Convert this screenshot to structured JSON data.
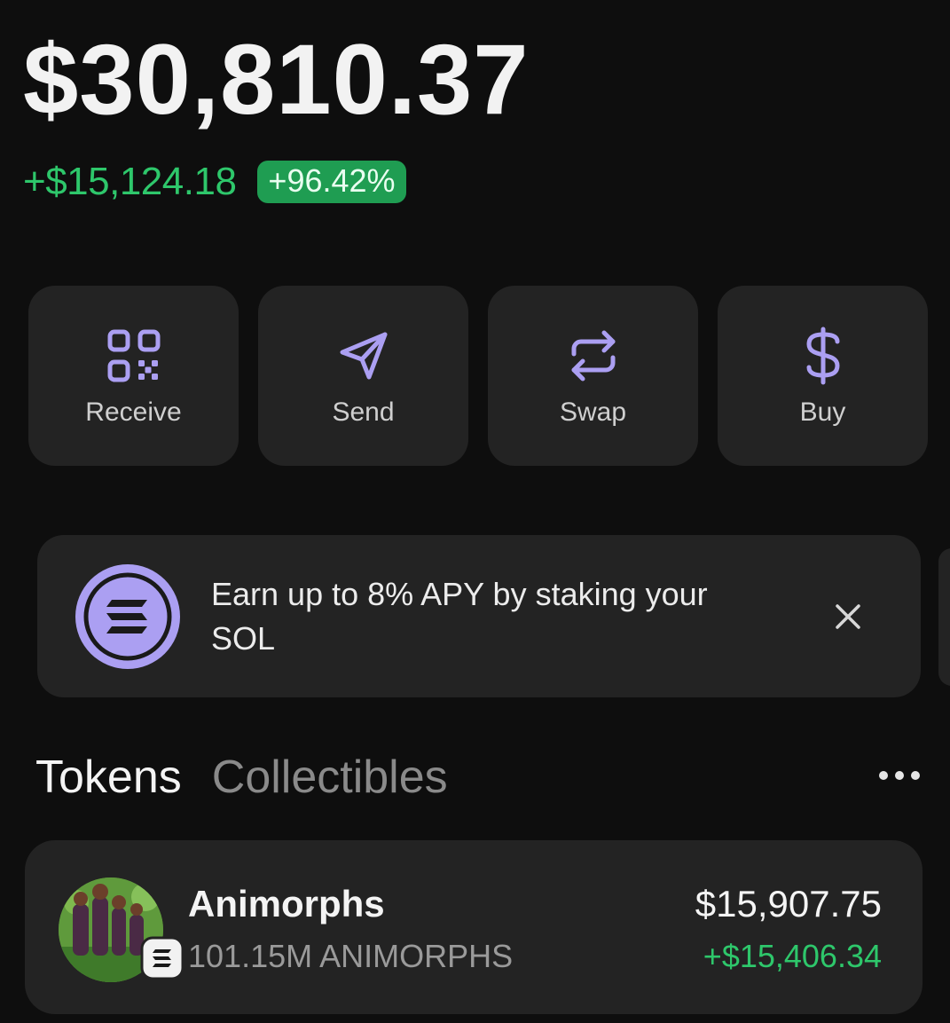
{
  "wallet": {
    "balance": "$30,810.37",
    "change_amount": "+$15,124.18",
    "change_percent": "+96.42%"
  },
  "actions": [
    {
      "label": "Receive",
      "icon": "qr-code-icon"
    },
    {
      "label": "Send",
      "icon": "send-icon"
    },
    {
      "label": "Swap",
      "icon": "swap-icon"
    },
    {
      "label": "Buy",
      "icon": "dollar-icon"
    }
  ],
  "banner": {
    "text": "Earn up to 8% APY by staking your SOL",
    "icon": "solana-icon",
    "close_icon": "close-icon"
  },
  "tabs": [
    {
      "label": "Tokens",
      "active": true
    },
    {
      "label": "Collectibles",
      "active": false
    }
  ],
  "tokens": [
    {
      "name": "Animorphs",
      "amount": "101.15M ANIMORPHS",
      "value": "$15,907.75",
      "change": "+$15,406.34"
    }
  ],
  "colors": {
    "background": "#0e0e0e",
    "card": "#232323",
    "accent": "#ab9ff2",
    "positive": "#2ec76b",
    "badge": "#1f9d52"
  }
}
